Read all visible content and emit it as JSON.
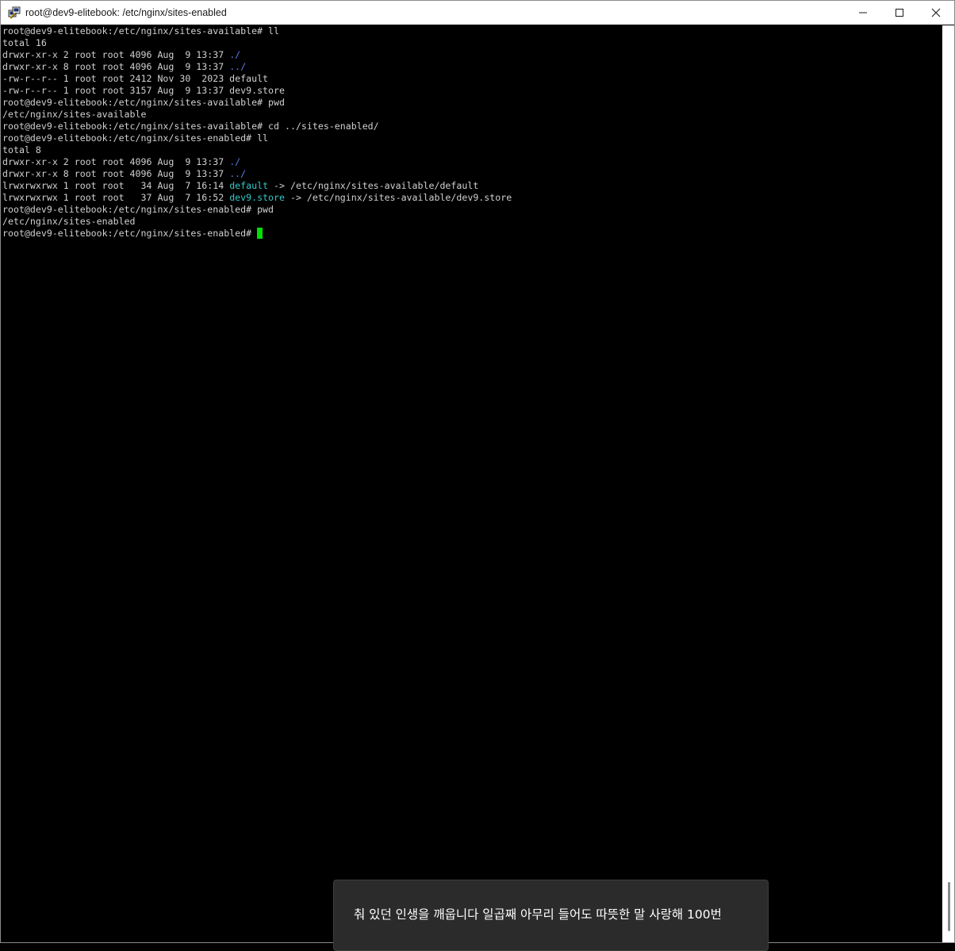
{
  "window": {
    "title": "root@dev9-elitebook: /etc/nginx/sites-enabled",
    "icon": "putty-icon",
    "controls": [
      "minimize-icon",
      "maximize-icon",
      "close-icon"
    ]
  },
  "terminal": {
    "colors": {
      "background": "#000000",
      "text": "#d0d0d0",
      "directory": "#5a7ee8",
      "symlink": "#33c7c7",
      "cursor": "#00e000"
    },
    "lines": [
      [
        {
          "t": "root@dev9-elitebook:/etc/nginx/sites-available# ll"
        }
      ],
      [
        {
          "t": "total 16"
        }
      ],
      [
        {
          "t": "drwxr-xr-x 2 root root 4096 Aug  9 13:37 "
        },
        {
          "t": "./",
          "c": "dir"
        }
      ],
      [
        {
          "t": "drwxr-xr-x 8 root root 4096 Aug  9 13:37 "
        },
        {
          "t": "../",
          "c": "dir"
        }
      ],
      [
        {
          "t": "-rw-r--r-- 1 root root 2412 Nov 30  2023 default"
        }
      ],
      [
        {
          "t": "-rw-r--r-- 1 root root 3157 Aug  9 13:37 dev9.store"
        }
      ],
      [
        {
          "t": "root@dev9-elitebook:/etc/nginx/sites-available# pwd"
        }
      ],
      [
        {
          "t": "/etc/nginx/sites-available"
        }
      ],
      [
        {
          "t": "root@dev9-elitebook:/etc/nginx/sites-available# cd ../sites-enabled/"
        }
      ],
      [
        {
          "t": "root@dev9-elitebook:/etc/nginx/sites-enabled# ll"
        }
      ],
      [
        {
          "t": "total 8"
        }
      ],
      [
        {
          "t": "drwxr-xr-x 2 root root 4096 Aug  9 13:37 "
        },
        {
          "t": "./",
          "c": "dir"
        }
      ],
      [
        {
          "t": "drwxr-xr-x 8 root root 4096 Aug  9 13:37 "
        },
        {
          "t": "../",
          "c": "dir"
        }
      ],
      [
        {
          "t": "lrwxrwxrwx 1 root root   34 Aug  7 16:14 "
        },
        {
          "t": "default",
          "c": "link"
        },
        {
          "t": " -> /etc/nginx/sites-available/default"
        }
      ],
      [
        {
          "t": "lrwxrwxrwx 1 root root   37 Aug  7 16:52 "
        },
        {
          "t": "dev9.store",
          "c": "link"
        },
        {
          "t": " -> /etc/nginx/sites-available/dev9.store"
        }
      ],
      [
        {
          "t": "root@dev9-elitebook:/etc/nginx/sites-enabled# pwd"
        }
      ],
      [
        {
          "t": "/etc/nginx/sites-enabled"
        }
      ],
      [
        {
          "t": "root@dev9-elitebook:/etc/nginx/sites-enabled#"
        }
      ]
    ]
  },
  "toast": {
    "text": "춰 있던 인생을 깨웁니다 일곱째 아무리 들어도 따뜻한 말 사랑해 100번"
  }
}
